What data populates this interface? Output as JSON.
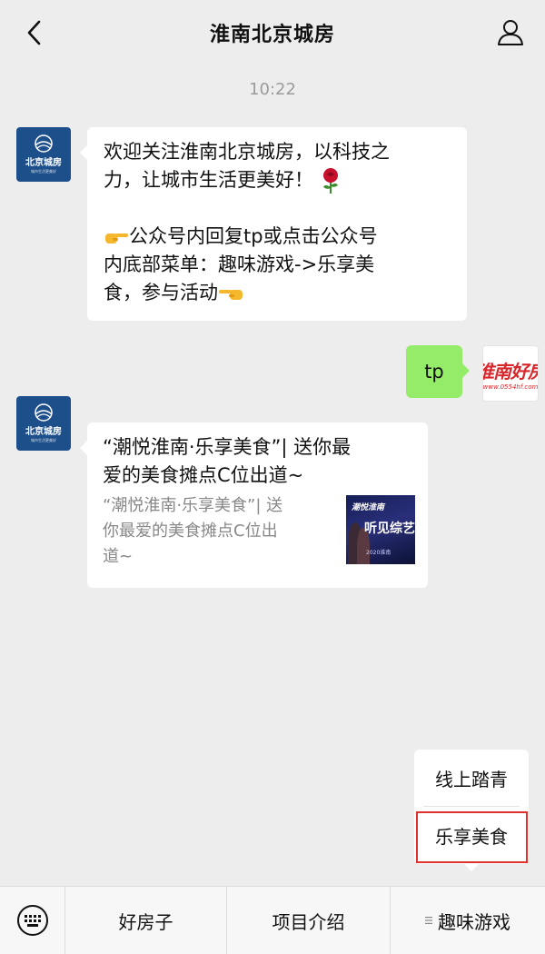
{
  "header": {
    "title": "淮南北京城房",
    "back_icon": "chevron-left-icon",
    "profile_icon": "person-icon"
  },
  "chat": {
    "timestamp": "10:22",
    "messages": [
      {
        "sender": "official-account",
        "avatar": {
          "text": "北京城房",
          "subtext": "城市生活更美好"
        },
        "lines": [
          "欢迎关注淮南北京城房，以科技之",
          "力，让城市生活更美好！"
        ],
        "lines2": [
          "公众号内回复tp或点击公众号",
          "内底部菜单：趣味游戏->乐享美",
          "食，参与活动"
        ],
        "emoji": {
          "rose": "rose-icon",
          "point_right": "pointing-hand-right-icon",
          "point_left": "pointing-hand-left-icon"
        }
      },
      {
        "sender": "user",
        "text": "tp",
        "avatar": {
          "text": "淮南好房",
          "subtext": "www.0554hf.com"
        }
      },
      {
        "sender": "official-account",
        "type": "article",
        "title_lines": [
          "“潮悦淮南·乐享美食”| 送你最",
          "爱的美食摊点C位出道~"
        ],
        "desc_lines": [
          "“潮悦淮南·乐享美食”| 送",
          "你最爱的美食摊点C位出",
          "道~"
        ],
        "thumbnail": {
          "line1": "潮悦淮南",
          "line2": "听见综艺",
          "line3": "2020淮南"
        }
      }
    ]
  },
  "submenu": {
    "items": [
      "线上踏青",
      "乐享美食"
    ],
    "highlighted_index": 1,
    "highlight_color": "#e0312d"
  },
  "bottom_menu": {
    "keyboard_icon": "keyboard-icon",
    "items": [
      "好房子",
      "项目介绍",
      "趣味游戏"
    ]
  },
  "colors": {
    "background": "#ededed",
    "sent_bubble": "#95ec69",
    "brand_blue": "#1d4f8b",
    "timestamp": "#9b9b9b"
  }
}
